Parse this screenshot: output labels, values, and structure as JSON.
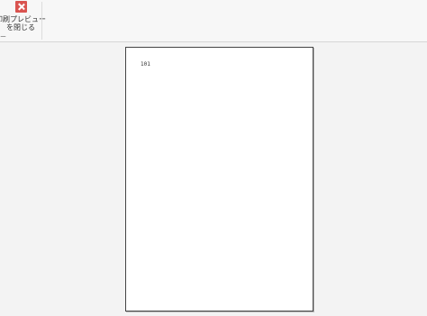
{
  "ribbon": {
    "close_preview_label_line1": "印刷プレビュー",
    "close_preview_label_line2": "を閉じる",
    "group_label": "ー"
  },
  "page": {
    "content_text": "101"
  },
  "colors": {
    "close_icon": "#d9534f",
    "background": "#f3f3f3",
    "page": "#ffffff"
  }
}
